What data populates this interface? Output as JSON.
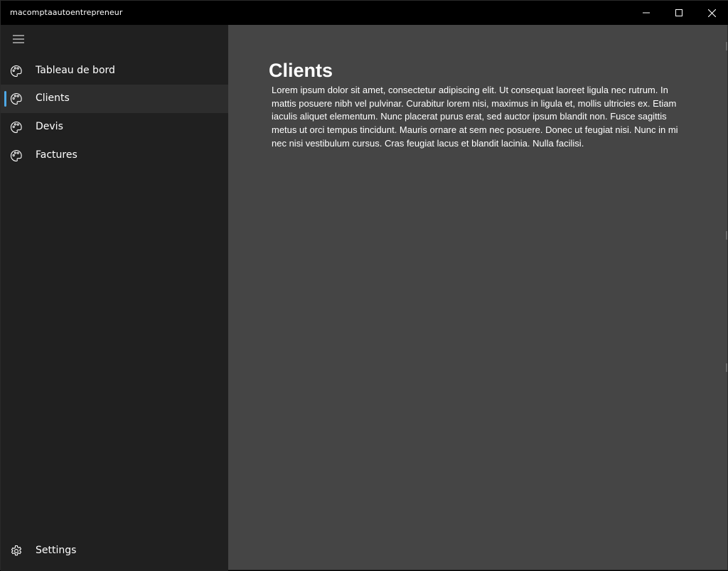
{
  "window": {
    "title": "macomptaautoentrepreneur",
    "controls": {
      "minimize_icon": "minimize-icon",
      "maximize_icon": "maximize-icon",
      "close_icon": "close-icon"
    }
  },
  "colors": {
    "titlebar_bg": "#000000",
    "sidebar_bg": "#202020",
    "selected_item_bg": "#2d2d2d",
    "content_bg": "#454545",
    "accent": "#4ea8e6",
    "text": "#ffffff"
  },
  "sidebar": {
    "menu_icon": "hamburger-icon",
    "items": [
      {
        "label": "Tableau de bord",
        "icon": "palette-icon",
        "selected": false
      },
      {
        "label": "Clients",
        "icon": "palette-icon",
        "selected": true
      },
      {
        "label": "Devis",
        "icon": "palette-icon",
        "selected": false
      },
      {
        "label": "Factures",
        "icon": "palette-icon",
        "selected": false
      }
    ],
    "footer": {
      "label": "Settings",
      "icon": "gear-icon"
    }
  },
  "main": {
    "title": "Clients",
    "body": "Lorem ipsum dolor sit amet, consectetur adipiscing elit. Ut consequat laoreet ligula nec rutrum. In mattis posuere nibh vel pulvinar. Curabitur lorem nisi, maximus in ligula et, mollis ultricies ex. Etiam iaculis aliquet elementum. Nunc placerat purus erat, sed auctor ipsum blandit non. Fusce sagittis metus ut orci tempus tincidunt. Mauris ornare at sem nec posuere. Donec ut feugiat nisi. Nunc in mi nec nisi vestibulum cursus. Cras feugiat lacus et blandit lacinia. Nulla facilisi."
  }
}
